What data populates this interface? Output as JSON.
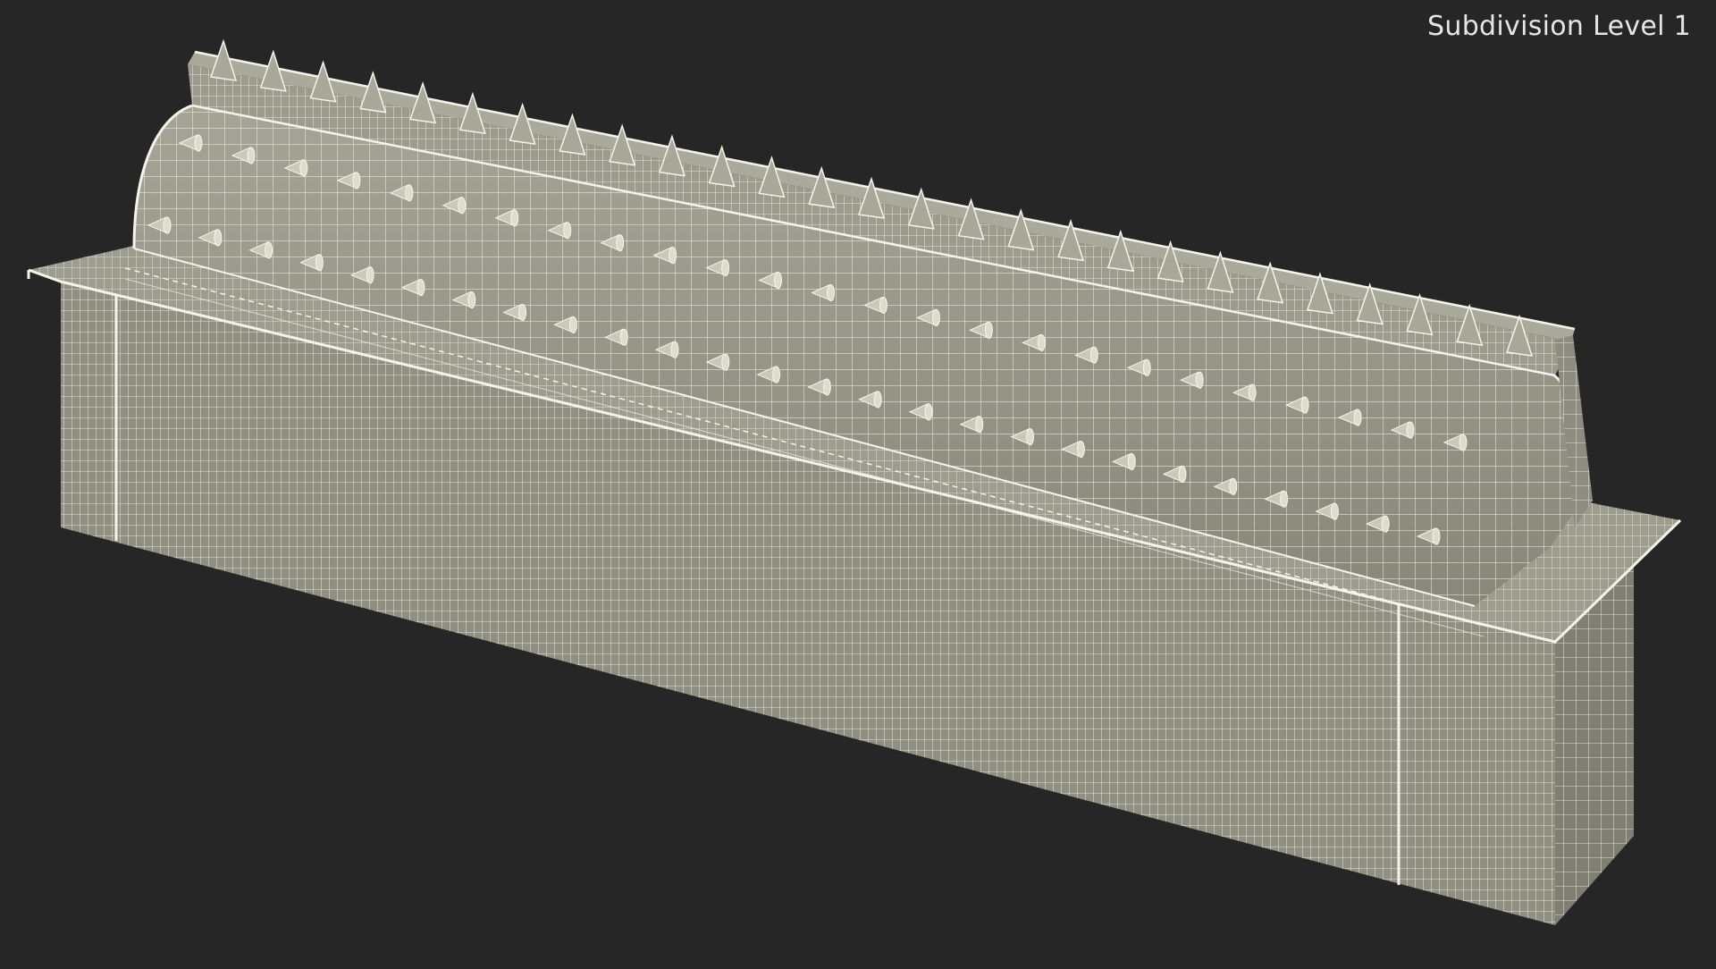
{
  "viewport": {
    "overlay_label": "Subdivision Level 1",
    "background_color": "#262626",
    "mesh_fill_color": "#8e8e80",
    "wire_color": "#f0efe4",
    "subject": "wireframe 3D model of a spiked rotating barrier on a box base",
    "display_mode": "wireframe over solid"
  }
}
